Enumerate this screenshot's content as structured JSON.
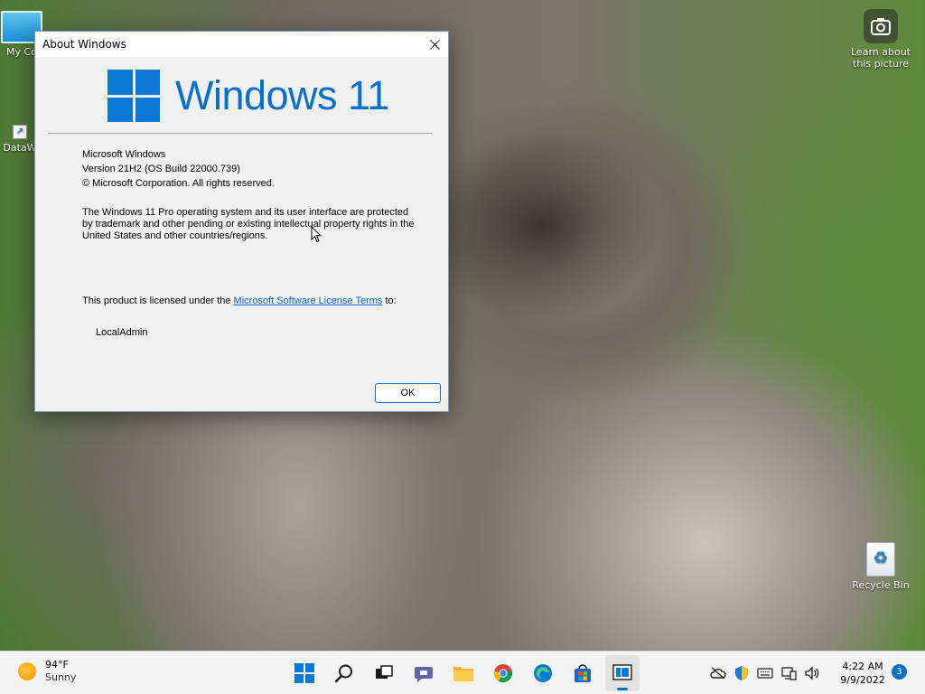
{
  "desktop": {
    "icons": [
      {
        "label": "My Co"
      },
      {
        "label": "DataW"
      },
      {
        "label": "Learn about this picture"
      },
      {
        "label": "Recycle Bin"
      }
    ]
  },
  "dialog": {
    "title": "About Windows",
    "logo_text": "Windows 11",
    "product_name": "Microsoft Windows",
    "version": "Version 21H2 (OS Build 22000.739)",
    "copyright": "© Microsoft Corporation. All rights reserved.",
    "legal": "The Windows 11 Pro operating system and its user interface are protected by trademark and other pending or existing intellectual property rights in the United States and other countries/regions.",
    "license_prefix": "This product is licensed under the ",
    "license_link": "Microsoft Software License Terms",
    "license_suffix": " to:",
    "licensee": "LocalAdmin",
    "ok_label": "OK"
  },
  "taskbar": {
    "weather_temp": "94°F",
    "weather_condition": "Sunny",
    "clock_time": "4:22 AM",
    "clock_date": "9/9/2022",
    "notification_count": "3",
    "apps": [
      "start",
      "search",
      "task-view",
      "teams-chat",
      "file-explorer",
      "chrome",
      "edge",
      "store",
      "about-windows"
    ]
  },
  "colors": {
    "accent": "#0a6fc7",
    "dialog_bg": "#f0f0f0",
    "taskbar_bg": "#f3f3f3"
  }
}
